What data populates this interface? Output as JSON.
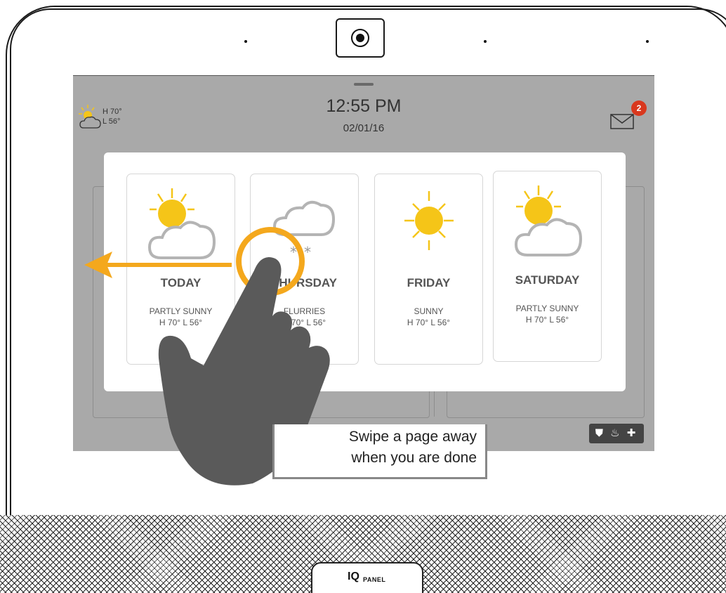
{
  "status_bar": {
    "weather_high": "H 70°",
    "weather_low": "L 56°",
    "time": "12:55 PM",
    "date": "02/01/16",
    "unread_messages": "2"
  },
  "forecast": [
    {
      "day": "TODAY",
      "condition": "PARTLY SUNNY",
      "temps": "H 70°   L 56°",
      "icon": "partly-sunny-icon"
    },
    {
      "day": "THURSDAY",
      "condition": "FLURRIES",
      "temps": "H 70°   L 56°",
      "icon": "flurries-icon"
    },
    {
      "day": "FRIDAY",
      "condition": "SUNNY",
      "temps": "H 70°   L 56°",
      "icon": "sunny-icon"
    },
    {
      "day": "SATURDAY",
      "condition": "PARTLY SUNNY",
      "temps": "H 70°   L 56°",
      "icon": "partly-sunny-icon"
    }
  ],
  "emergency_button": {
    "icons": [
      "shield-icon",
      "fire-icon",
      "plus-icon"
    ],
    "label": "⛊ ♨ ✚"
  },
  "callout": {
    "line1": "Swipe a page away",
    "line2": "when you are done"
  },
  "brand": {
    "iq": "IQ",
    "panel": "PANEL"
  },
  "colors": {
    "accent": "#f4a81d",
    "sun": "#f5c518",
    "badge": "#d9381e",
    "screen_dim": "#a9a9a9",
    "hand": "#5a5a5a"
  }
}
